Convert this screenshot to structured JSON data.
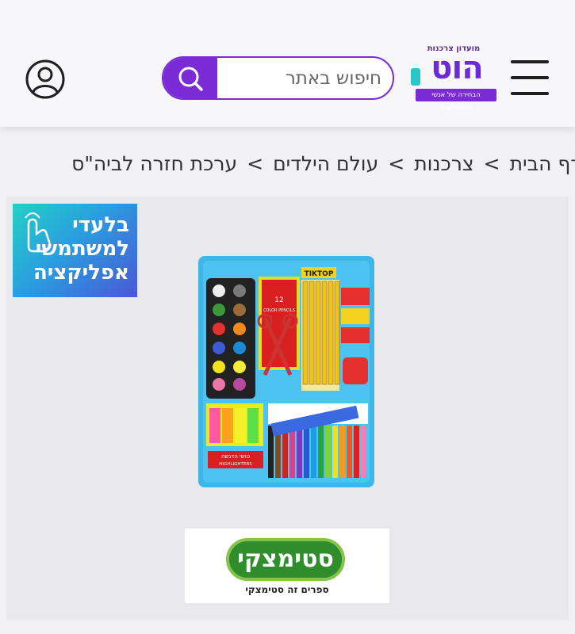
{
  "header": {
    "logo": {
      "top_text": "מועדון צרכנות",
      "word": "הוט",
      "strip_text": "הבחירה של אנשי הטכנולוגיה"
    },
    "search": {
      "placeholder": "חיפוש באתר"
    },
    "icons": {
      "menu": "hamburger-menu-icon",
      "search": "search-icon",
      "user": "user-account-icon"
    }
  },
  "breadcrumb": {
    "items": [
      "דף הבית",
      "צרכנות",
      "עולם הילדים",
      "ערכת חזרה לביה\"ס"
    ],
    "separator": ">"
  },
  "promo": {
    "app_banner_text": "בלעדי למשתמשי אפליקציה"
  },
  "product": {
    "image_alt": "ערכת חזרה לביה\"ס",
    "package_labels": [
      "TIKTOP",
      "12",
      "COLOR PENCILS",
      "HIGHLIGHTERS",
      "טושי הדגשה"
    ]
  },
  "brand": {
    "name": "סטימצקי",
    "tagline": "ספרים זה סטימצקי"
  },
  "colors": {
    "accent": "#7a2bd6",
    "teal": "#2cc6c9",
    "brand_green": "#2f8d2c"
  }
}
